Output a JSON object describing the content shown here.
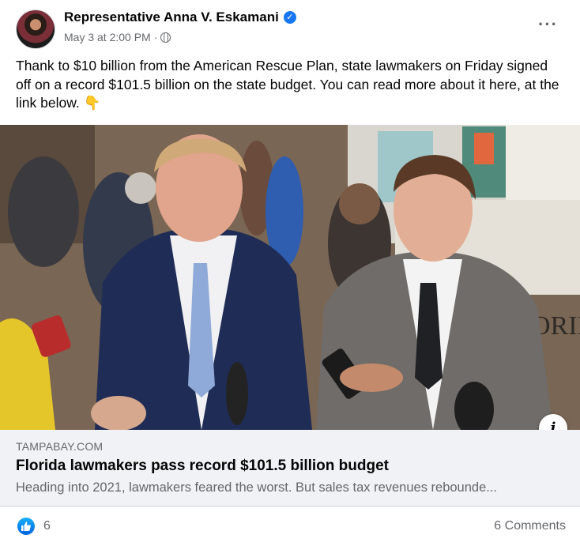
{
  "post": {
    "author": "Representative Anna V. Eskamani",
    "timestamp": "May 3 at 2:00 PM",
    "separator": "·",
    "text": "Thank to $10 billion from the American Rescue Plan, state lawmakers on Friday signed off on a record $101.5 billion on the state budget. You can read more about it here, at the link below. 👇"
  },
  "link": {
    "domain": "TAMPABAY.COM",
    "title": "Florida lawmakers pass record $101.5 billion budget",
    "description": "Heading into 2021, lawmakers feared the worst. But sales tax revenues rebounde..."
  },
  "photo": {
    "sign_text": "ORID"
  },
  "reactions": {
    "like_count": "6",
    "comments_label": "6 Comments"
  },
  "icons": {
    "verified": "verified-badge-icon",
    "privacy": "globe-icon",
    "menu": "more-options-icon",
    "info": "info-icon",
    "reaction": "like-icon"
  },
  "colors": {
    "accent": "#1877f2",
    "secondary_text": "#65676b",
    "card_bg": "#f0f2f5"
  }
}
